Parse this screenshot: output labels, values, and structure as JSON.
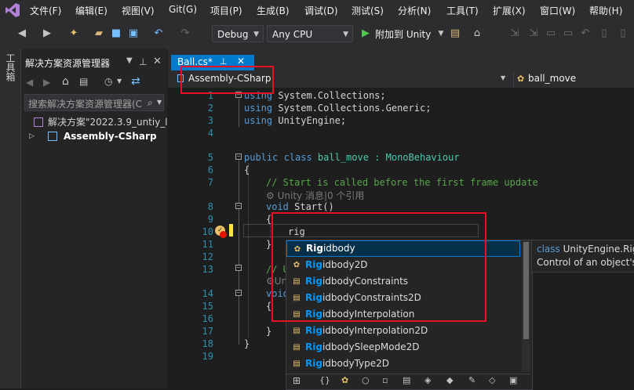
{
  "menu": {
    "items": [
      "文件(F)",
      "编辑(E)",
      "视图(V)",
      "Git(G)",
      "项目(P)",
      "生成(B)",
      "调试(D)",
      "测试(S)",
      "分析(N)",
      "工具(T)",
      "扩展(X)",
      "窗口(W)",
      "帮助(H)"
    ]
  },
  "toolbar": {
    "config": "Debug",
    "platform": "Any CPU",
    "attach_label": "附加到 Unity"
  },
  "toolstrip": {
    "label": "工具箱"
  },
  "solution_explorer": {
    "title": "解决方案资源管理器",
    "search_placeholder": "搜索解决方案资源管理器(C",
    "solution_label": "解决方案\"2022.3.9_untiy_le",
    "project_label": "Assembly-CSharp"
  },
  "editor": {
    "tab_label": "Ball.cs*",
    "nav_project": "Assembly-CSharp",
    "nav_class": "ball_move",
    "lines": [
      "1",
      "2",
      "3",
      "4",
      "5",
      "6",
      "7",
      "8",
      "9",
      "10",
      "11",
      "12",
      "13",
      "14",
      "15",
      "16",
      "17",
      "18",
      "19"
    ],
    "code": {
      "l1_kw": "using",
      "l1_rest": " System.Collections;",
      "l2_kw": "using",
      "l2_rest": " System.Collections.Generic;",
      "l3_kw": "using",
      "l3_rest": " UnityEngine;",
      "l5_kw": "public class",
      "l5_name": " ball_move : ",
      "l5_base": "MonoBehaviour",
      "l6": "{",
      "l7": "// Start is called before the first frame update",
      "l7_hint": "Unity 消息|0 个引用",
      "l8_kw": "void",
      "l8_rest": " Start()",
      "l9": "{",
      "l10": "rig",
      "l11": "}",
      "l13": "// U",
      "l13_hint": "Un",
      "l14_kw": "void",
      "l15": "{",
      "l17": "}",
      "l18": "}"
    }
  },
  "completion": {
    "match": "Rig",
    "items": [
      {
        "rest": "idbody",
        "icon": "class-icon"
      },
      {
        "rest": "idbody2D",
        "icon": "class-icon"
      },
      {
        "rest": "idbodyConstraints",
        "icon": "enum-icon"
      },
      {
        "rest": "idbodyConstraints2D",
        "icon": "enum-icon"
      },
      {
        "rest": "idbodyInterpolation",
        "icon": "enum-icon"
      },
      {
        "rest": "idbodyInterpolation2D",
        "icon": "enum-icon"
      },
      {
        "rest": "idbodySleepMode2D",
        "icon": "enum-icon"
      },
      {
        "rest": "idbodyType2D",
        "icon": "enum-icon"
      }
    ],
    "tooltip_kw": "class",
    "tooltip_name": " UnityEngine.Rigi",
    "tooltip_desc": "Control of an object's"
  },
  "colors": {
    "accent": "#007acc",
    "highlight": "#e81123",
    "match": "#0097fb"
  }
}
